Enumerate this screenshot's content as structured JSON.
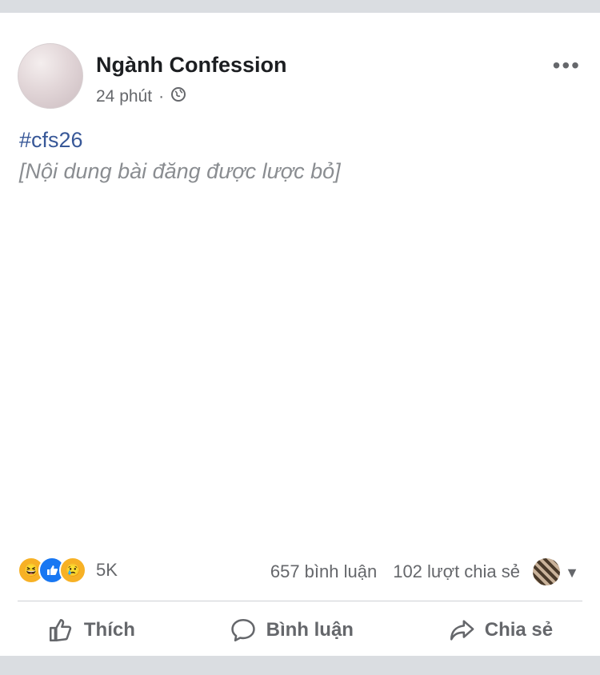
{
  "post": {
    "author": "Ngành Confession",
    "time": "24 phút",
    "separator": "·",
    "privacy_icon": "globe-icon",
    "hashtag": "#cfs26",
    "body_placeholder": "[Nội dung bài đăng được lược bỏ]"
  },
  "reactions": {
    "icons": [
      "haha-icon",
      "like-icon",
      "sad-icon"
    ],
    "count": "5K"
  },
  "stats": {
    "comments": "657 bình luận",
    "shares": "102 lượt chia sẻ"
  },
  "actions": {
    "like": "Thích",
    "comment": "Bình luận",
    "share": "Chia sẻ"
  },
  "colors": {
    "hashtag": "#385898",
    "secondary_text": "#65676b",
    "like_blue": "#1877f2",
    "emoji_yellow": "#f7b125"
  }
}
